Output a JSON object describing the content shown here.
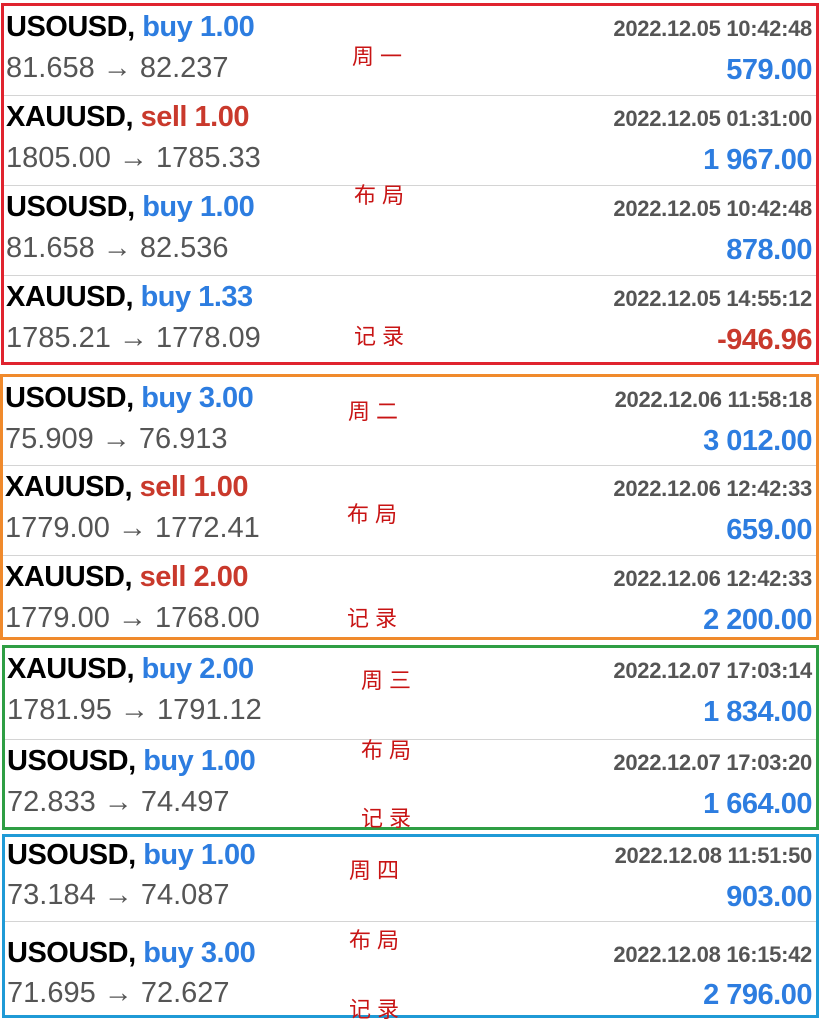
{
  "groups": [
    {
      "color": "#e0232e",
      "notes": [
        "周一",
        "布局",
        "记录"
      ],
      "trades": [
        {
          "symbol": "USOUSD,",
          "side": "buy",
          "volume": "1.00",
          "price_open": "81.658",
          "arrow": "→",
          "price_close": "82.237",
          "time": "2022.12.05 10:42:48",
          "profit": "579.00"
        },
        {
          "symbol": "XAUUSD,",
          "side": "sell",
          "volume": "1.00",
          "price_open": "1805.00",
          "arrow": "→",
          "price_close": "1785.33",
          "time": "2022.12.05 01:31:00",
          "profit": "1 967.00"
        },
        {
          "symbol": "USOUSD,",
          "side": "buy",
          "volume": "1.00",
          "price_open": "81.658",
          "arrow": "→",
          "price_close": "82.536",
          "time": "2022.12.05 10:42:48",
          "profit": "878.00"
        },
        {
          "symbol": "XAUUSD,",
          "side": "buy",
          "volume": "1.33",
          "price_open": "1785.21",
          "arrow": "→",
          "price_close": "1778.09",
          "time": "2022.12.05 14:55:12",
          "profit": "-946.96"
        }
      ]
    },
    {
      "color": "#f08a2c",
      "notes": [
        "周二",
        "布局",
        "记录"
      ],
      "trades": [
        {
          "symbol": "USOUSD,",
          "side": "buy",
          "volume": "3.00",
          "price_open": "75.909",
          "arrow": "→",
          "price_close": "76.913",
          "time": "2022.12.06 11:58:18",
          "profit": "3 012.00"
        },
        {
          "symbol": "XAUUSD,",
          "side": "sell",
          "volume": "1.00",
          "price_open": "1779.00",
          "arrow": "→",
          "price_close": "1772.41",
          "time": "2022.12.06 12:42:33",
          "profit": "659.00"
        },
        {
          "symbol": "XAUUSD,",
          "side": "sell",
          "volume": "2.00",
          "price_open": "1779.00",
          "arrow": "→",
          "price_close": "1768.00",
          "time": "2022.12.06 12:42:33",
          "profit": "2 200.00"
        }
      ]
    },
    {
      "color": "#2e9e44",
      "notes": [
        "周三",
        "布局",
        "记录"
      ],
      "trades": [
        {
          "symbol": "XAUUSD,",
          "side": "buy",
          "volume": "2.00",
          "price_open": "1781.95",
          "arrow": "→",
          "price_close": "1791.12",
          "time": "2022.12.07 17:03:14",
          "profit": "1 834.00"
        },
        {
          "symbol": "USOUSD,",
          "side": "buy",
          "volume": "1.00",
          "price_open": "72.833",
          "arrow": "→",
          "price_close": "74.497",
          "time": "2022.12.07 17:03:20",
          "profit": "1 664.00"
        }
      ]
    },
    {
      "color": "#1f9ad6",
      "notes": [
        "周四",
        "布局",
        "记录"
      ],
      "trades": [
        {
          "symbol": "USOUSD,",
          "side": "buy",
          "volume": "1.00",
          "price_open": "73.184",
          "arrow": "→",
          "price_close": "74.087",
          "time": "2022.12.08 11:51:50",
          "profit": "903.00"
        },
        {
          "symbol": "USOUSD,",
          "side": "buy",
          "volume": "3.00",
          "price_open": "71.695",
          "arrow": "→",
          "price_close": "72.627",
          "time": "2022.12.08 16:15:42",
          "profit": "2 796.00"
        }
      ]
    }
  ]
}
